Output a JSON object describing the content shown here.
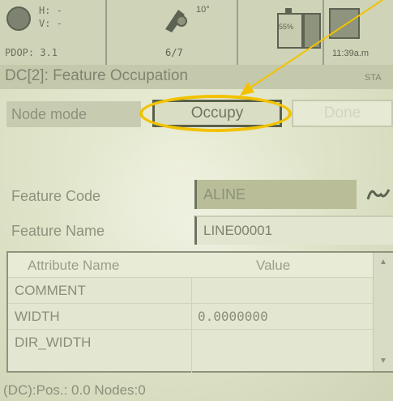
{
  "status_bar": {
    "h_label": "H: -",
    "v_label": "V: -",
    "pdop_label": "PDOP: 3.1",
    "tilt": "10°",
    "sat_ratio": "6/7",
    "battery_pct": "55%",
    "time": "11:39a.m"
  },
  "title": {
    "text": "DC[2]: Feature Occupation",
    "right_text": "STA"
  },
  "node_mode": {
    "label": "Node mode",
    "occupy_label": "Occupy",
    "done_label": "Done"
  },
  "feature": {
    "code_label": "Feature Code",
    "code_value": "ALINE",
    "name_label": "Feature Name",
    "name_value": "LINE00001"
  },
  "attributes": {
    "headers": [
      "Attribute Name",
      "Value"
    ],
    "rows": [
      {
        "name": "COMMENT",
        "value": ""
      },
      {
        "name": "WIDTH",
        "value": "0.0000000"
      },
      {
        "name": "DIR_WIDTH",
        "value": ""
      }
    ]
  },
  "footer": {
    "status": "(DC):Pos.: 0.0 Nodes:0"
  },
  "colors": {
    "screen_bg": "#e3e6cf",
    "highlight": "#f2c200",
    "text": "#8a8f79"
  }
}
